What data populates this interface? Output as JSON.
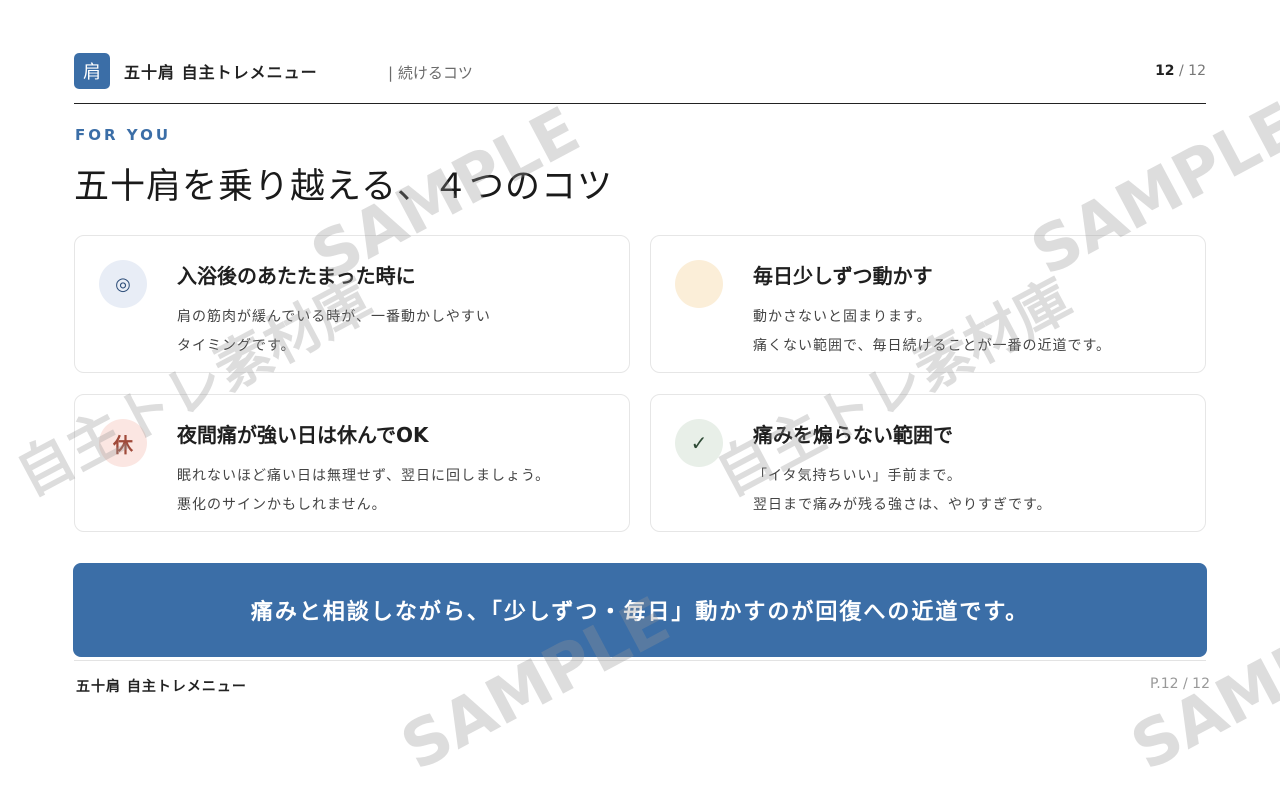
{
  "header": {
    "logo_glyph": "肩",
    "app_title": "五十肩 自主トレメニュー",
    "section": "| 続けるコツ",
    "page_current": "12",
    "page_sep": " / ",
    "page_total": "12"
  },
  "eyebrow": "FOR YOU",
  "page_title": "五十肩を乗り越える、４つのコツ",
  "cards": [
    {
      "icon_glyph": "◎",
      "icon_name": "target-icon",
      "title": "入浴後のあたたまった時に",
      "line1": "肩の筋肉が緩んでいる時が、一番動かしやすい",
      "line2": "タイミングです。"
    },
    {
      "icon_glyph": "",
      "icon_name": "sun-circle-icon",
      "title": "毎日少しずつ動かす",
      "line1": "動かさないと固まります。",
      "line2": "痛くない範囲で、毎日続けることが一番の近道です。"
    },
    {
      "icon_glyph": "休",
      "icon_name": "rest-icon",
      "title": "夜間痛が強い日は休んでOK",
      "line1": "眠れないほど痛い日は無理せず、翌日に回しましょう。",
      "line2": "悪化のサインかもしれません。"
    },
    {
      "icon_glyph": "✓",
      "icon_name": "check-icon",
      "title": "痛みを煽らない範囲で",
      "line1": "「イタ気持ちいい」手前まで。",
      "line2": "翌日まで痛みが残る強さは、やりすぎです。"
    }
  ],
  "banner_text": "痛みと相談しながら、「少しずつ・毎日」動かすのが回復への近道です。",
  "footer": {
    "title": "五十肩 自主トレメニュー",
    "page": "P.12 / 12"
  },
  "watermarks": {
    "sample": "SAMPLE",
    "library": "自主トレ素材庫"
  },
  "colors": {
    "accent": "#3b6ea7",
    "icon1_bg": "#e8edf6",
    "icon2_bg": "#fbeed8",
    "icon3_bg": "#fbe6e2",
    "icon4_bg": "#e8efe8"
  }
}
